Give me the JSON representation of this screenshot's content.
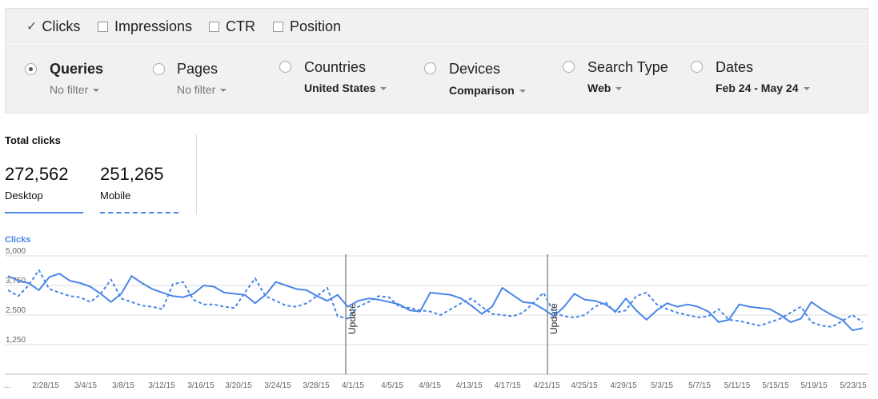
{
  "metrics": [
    {
      "label": "Clicks",
      "checked": true
    },
    {
      "label": "Impressions",
      "checked": false
    },
    {
      "label": "CTR",
      "checked": false
    },
    {
      "label": "Position",
      "checked": false
    }
  ],
  "filters": [
    {
      "title": "Queries",
      "value": "No filter",
      "selected": true
    },
    {
      "title": "Pages",
      "value": "No filter",
      "selected": false
    },
    {
      "title": "Countries",
      "value": "United States",
      "selected": false
    },
    {
      "title": "Devices",
      "value": "Comparison",
      "selected": false
    },
    {
      "title": "Search Type",
      "value": "Web",
      "selected": false
    },
    {
      "title": "Dates",
      "value": "Feb 24 - May 24",
      "selected": false
    }
  ],
  "totals": {
    "title": "Total clicks",
    "desktop": {
      "value": "272,562",
      "label": "Desktop"
    },
    "mobile": {
      "value": "251,265",
      "label": "Mobile"
    }
  },
  "colors": {
    "desktop": "#4a86e8",
    "mobile": "#4a86e8",
    "annotation": "#555555",
    "grid": "#dddddd"
  },
  "chart_data": {
    "type": "line",
    "title": "Clicks",
    "ylim": [
      0,
      5000
    ],
    "yticks": [
      "5,000",
      "3,750",
      "2,500",
      "1,250"
    ],
    "ytick_values": [
      5000,
      3750,
      2500,
      1250
    ],
    "xticks": [
      "...",
      "2/28/15",
      "3/4/15",
      "3/8/15",
      "3/12/15",
      "3/16/15",
      "3/20/15",
      "3/24/15",
      "3/28/15",
      "4/1/15",
      "4/5/15",
      "4/9/15",
      "4/13/15",
      "4/17/15",
      "4/21/15",
      "4/25/15",
      "4/29/15",
      "5/3/15",
      "5/7/15",
      "5/11/15",
      "5/15/15",
      "5/19/15",
      "5/23/15"
    ],
    "annotations": [
      {
        "label": "Update",
        "date": "4/1/15"
      },
      {
        "label": "Update",
        "date": "4/21/15"
      }
    ],
    "series": [
      {
        "name": "Desktop",
        "style": "solid",
        "values": [
          4150,
          3950,
          3850,
          3550,
          4100,
          4250,
          3950,
          3850,
          3700,
          3400,
          3050,
          3400,
          4150,
          3850,
          3600,
          3450,
          3300,
          3250,
          3400,
          3750,
          3700,
          3450,
          3400,
          3350,
          3000,
          3350,
          3900,
          3750,
          3600,
          3550,
          3300,
          3100,
          3350,
          2850,
          3100,
          3200,
          3150,
          3050,
          2950,
          2700,
          2650,
          3450,
          3400,
          3350,
          3200,
          2900,
          2550,
          2850,
          3650,
          3350,
          3050,
          3000,
          2750,
          2450,
          2850,
          3400,
          3150,
          3100,
          2950,
          2650,
          3200,
          2700,
          2300,
          2700,
          3000,
          2850,
          2950,
          2850,
          2650,
          2200,
          2300,
          2950,
          2850,
          2800,
          2750,
          2500,
          2200,
          2350,
          3050,
          2750,
          2500,
          2300,
          1850,
          1950
        ]
      },
      {
        "name": "Mobile",
        "style": "dashed",
        "values": [
          3550,
          3300,
          3750,
          4400,
          3600,
          3450,
          3300,
          3250,
          3050,
          3400,
          4000,
          3200,
          3050,
          2900,
          2850,
          2750,
          3800,
          3900,
          3150,
          2950,
          2950,
          2850,
          2800,
          3450,
          4050,
          3300,
          3100,
          2900,
          2850,
          3000,
          3300,
          3650,
          2450,
          2350,
          2850,
          3050,
          3300,
          3250,
          2850,
          2800,
          2700,
          2650,
          2500,
          2750,
          3000,
          3200,
          2850,
          2550,
          2500,
          2450,
          2600,
          3000,
          3450,
          2600,
          2450,
          2400,
          2500,
          2850,
          3050,
          2600,
          2700,
          3300,
          3450,
          2950,
          2750,
          2600,
          2500,
          2400,
          2450,
          2750,
          2300,
          2250,
          2150,
          2050,
          2200,
          2350,
          2600,
          2850,
          2200,
          2050,
          2000,
          2250,
          2500,
          2200
        ]
      }
    ]
  }
}
